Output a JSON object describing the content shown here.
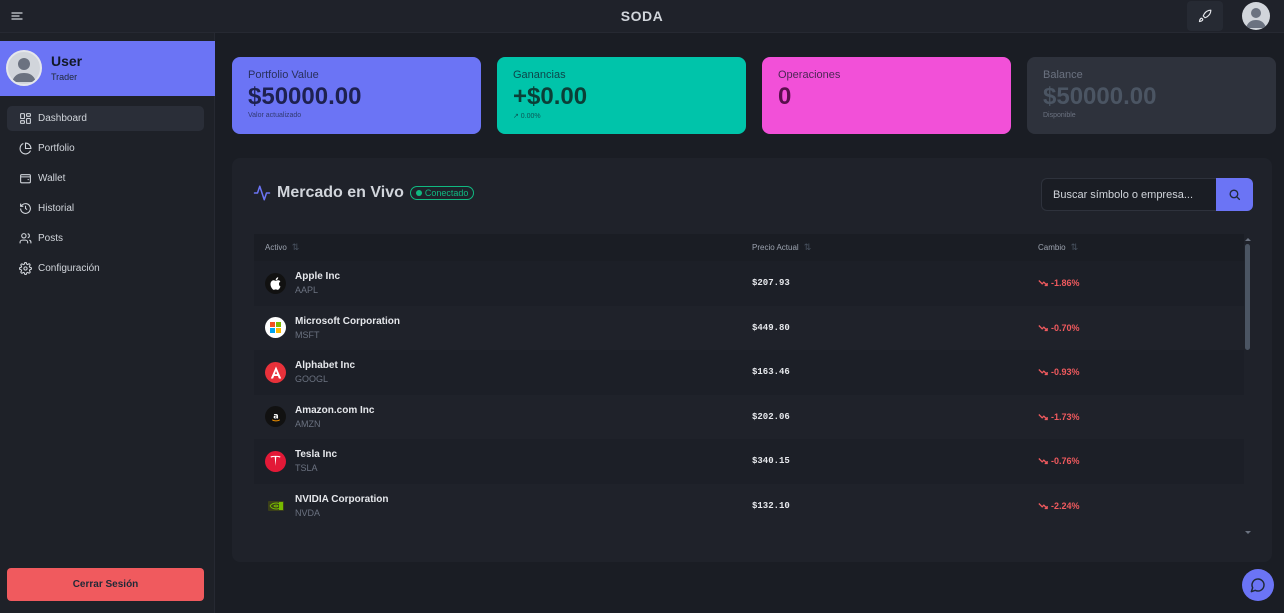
{
  "app": {
    "brand": "SODA"
  },
  "user": {
    "name": "User",
    "role": "Trader"
  },
  "nav": [
    {
      "label": "Dashboard",
      "icon": "dashboard-icon",
      "active": true
    },
    {
      "label": "Portfolio",
      "icon": "pie-chart-icon",
      "active": false
    },
    {
      "label": "Wallet",
      "icon": "wallet-icon",
      "active": false
    },
    {
      "label": "Historial",
      "icon": "history-icon",
      "active": false
    },
    {
      "label": "Posts",
      "icon": "users-icon",
      "active": false
    },
    {
      "label": "Configuración",
      "icon": "gear-icon",
      "active": false
    }
  ],
  "logout_label": "Cerrar Sesión",
  "stats": {
    "portfolio": {
      "label": "Portfolio Value",
      "value": "$50000.00",
      "sub": "Valor actualizado"
    },
    "gain": {
      "label": "Ganancias",
      "value": "+$0.00",
      "sub": "↗ 0.00%"
    },
    "ops": {
      "label": "Operaciones",
      "value": "0"
    },
    "balance": {
      "label": "Balance",
      "value": "$50000.00",
      "sub": "Disponible"
    }
  },
  "market": {
    "title": "Mercado en Vivo",
    "status": "Conectado",
    "search_placeholder": "Buscar símbolo o empresa...",
    "columns": {
      "asset": "Activo",
      "price": "Precio Actual",
      "change": "Cambio"
    },
    "rows": [
      {
        "name": "Apple Inc",
        "symbol": "AAPL",
        "price": "$207.93",
        "change": "-1.86%",
        "logo": "apple-logo-icon"
      },
      {
        "name": "Microsoft Corporation",
        "symbol": "MSFT",
        "price": "$449.80",
        "change": "-0.70%",
        "logo": "microsoft-logo-icon"
      },
      {
        "name": "Alphabet Inc",
        "symbol": "GOOGL",
        "price": "$163.46",
        "change": "-0.93%",
        "logo": "alphabet-logo-icon"
      },
      {
        "name": "Amazon.com Inc",
        "symbol": "AMZN",
        "price": "$202.06",
        "change": "-1.73%",
        "logo": "amazon-logo-icon"
      },
      {
        "name": "Tesla Inc",
        "symbol": "TSLA",
        "price": "$340.15",
        "change": "-0.76%",
        "logo": "tesla-logo-icon"
      },
      {
        "name": "NVIDIA Corporation",
        "symbol": "NVDA",
        "price": "$132.10",
        "change": "-2.24%",
        "logo": "nvidia-logo-icon"
      }
    ]
  },
  "colors": {
    "accent": "#6b74f5",
    "positive": "#10b981",
    "negative": "#f05a5e"
  }
}
